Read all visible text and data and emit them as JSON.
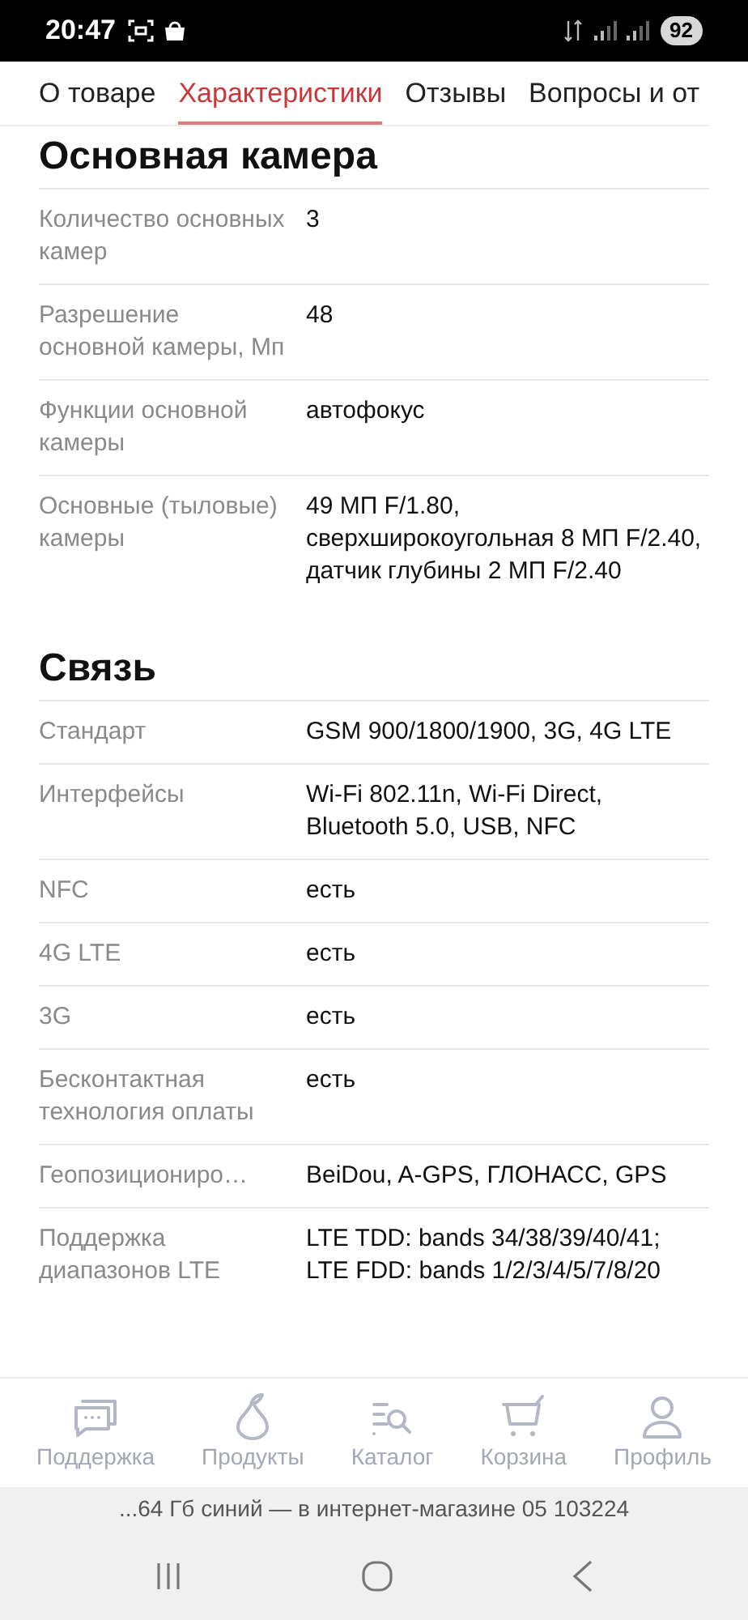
{
  "status_bar": {
    "time": "20:47",
    "battery": "92"
  },
  "tabs": [
    {
      "label": "О товаре",
      "selected": false
    },
    {
      "label": "Характеристики",
      "selected": true
    },
    {
      "label": "Отзывы",
      "selected": false
    },
    {
      "label": "Вопросы и от",
      "selected": false
    }
  ],
  "sections": [
    {
      "title": "Основная камера",
      "rows": [
        {
          "label": "Количество основных камер",
          "value": "3"
        },
        {
          "label": "Разрешение основной камеры, Мп",
          "value": "48"
        },
        {
          "label": "Функции основной камеры",
          "value": "автофокус"
        },
        {
          "label": "Основные (тыловые) камеры",
          "value": "49 МП F/1.80, сверхширокоугольная 8 МП F/2.40, датчик глубины 2 МП F/2.40"
        }
      ]
    },
    {
      "title": "Связь",
      "rows": [
        {
          "label": "Стандарт",
          "value": "GSM 900/1800/1900, 3G, 4G LTE"
        },
        {
          "label": "Интерфейсы",
          "value": "Wi-Fi 802.11n, Wi-Fi Direct, Bluetooth 5.0, USB, NFC"
        },
        {
          "label": "NFC",
          "value": "есть"
        },
        {
          "label": "4G LTE",
          "value": "есть"
        },
        {
          "label": "3G",
          "value": "есть"
        },
        {
          "label": "Бесконтактная технология оплаты",
          "value": "есть"
        },
        {
          "label": "Геопозициониро…",
          "value": "BeiDou, A-GPS, ГЛОНАСС, GPS"
        },
        {
          "label": "Поддержка диапазонов LTE",
          "value": "LTE TDD: bands 34/38/39/40/41; LTE FDD: bands 1/2/3/4/5/7/8/20"
        }
      ]
    }
  ],
  "bottom_nav": [
    {
      "kind": "support",
      "label": "Поддержка"
    },
    {
      "kind": "products",
      "label": "Продукты"
    },
    {
      "kind": "catalog",
      "label": "Каталог"
    },
    {
      "kind": "cart",
      "label": "Корзина"
    },
    {
      "kind": "profile",
      "label": "Профиль"
    }
  ],
  "url_bar": "...64 Гб синий — в интернет-магазине 05 103224"
}
